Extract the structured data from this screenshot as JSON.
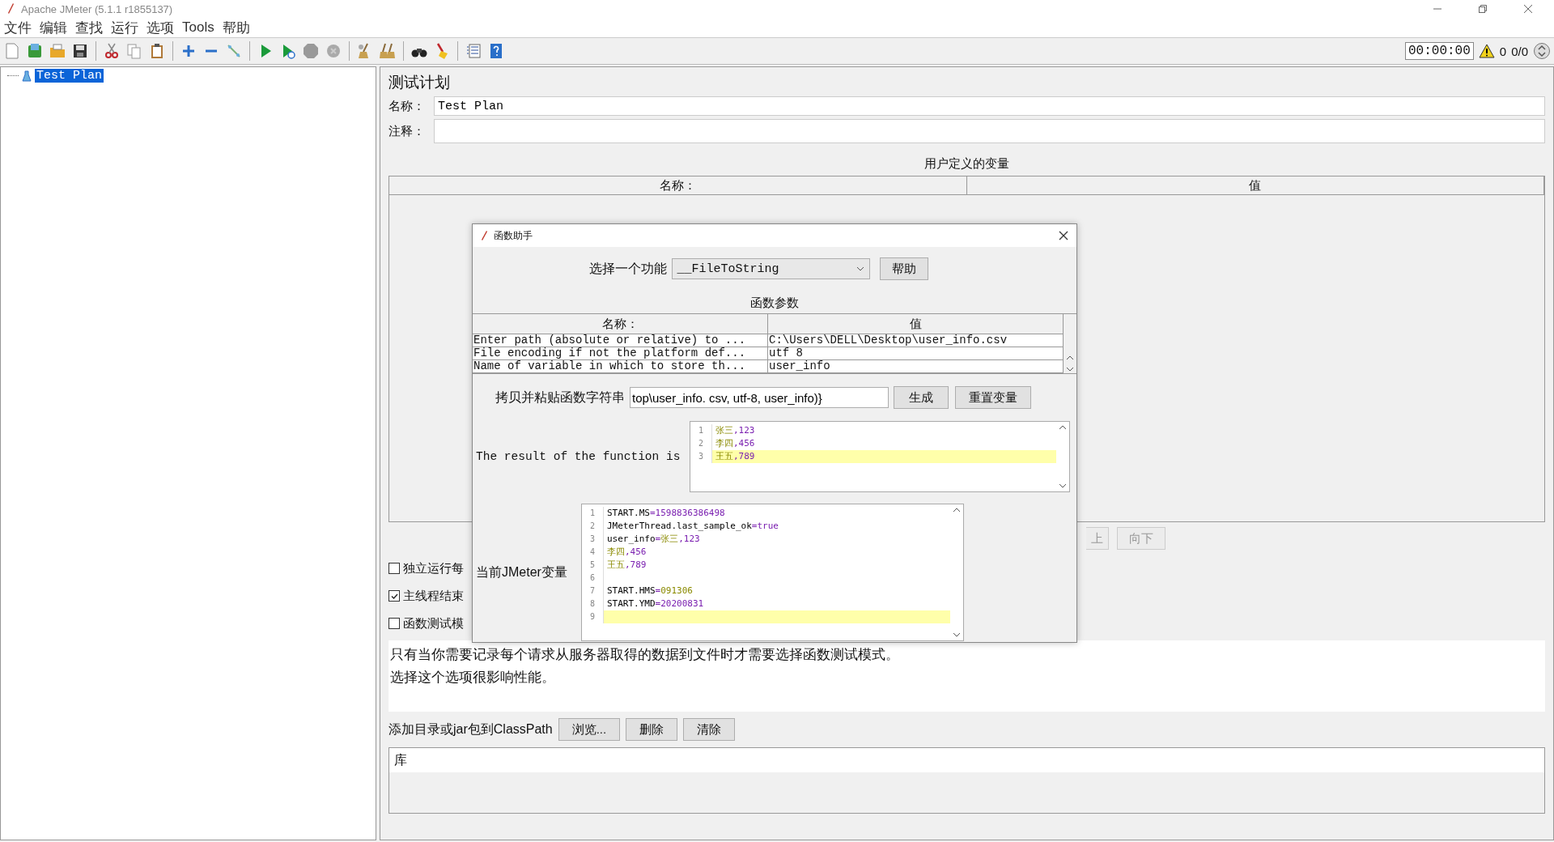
{
  "window": {
    "title": "Apache JMeter (5.1.1 r1855137)"
  },
  "menu": [
    "文件",
    "编辑",
    "查找",
    "运行",
    "选项",
    "Tools",
    "帮助"
  ],
  "status": {
    "timer": "00:00:00",
    "warnings": "0",
    "threads": "0/0"
  },
  "tree": [
    {
      "label": "Test Plan",
      "selected": true
    }
  ],
  "test_plan": {
    "title": "测试计划",
    "name_label": "名称：",
    "name": "Test Plan",
    "comment_label": "注释：",
    "variables": {
      "title": "用户定义的变量",
      "columns": [
        "名称：",
        "值"
      ]
    },
    "buttons": [
      "上",
      "向下"
    ],
    "options": [
      {
        "label": "独立运行每",
        "checked": false
      },
      {
        "label": "主线程结束",
        "checked": true
      },
      {
        "label": "函数测试模",
        "checked": false
      }
    ],
    "note": [
      "只有当你需要记录每个请求从服务器取得的数据到文件时才需要选择函数测试模式。",
      "选择这个选项很影响性能。"
    ],
    "classpath": {
      "label": "添加目录或jar包到ClassPath",
      "buttons": [
        "浏览...",
        "删除",
        "清除"
      ],
      "column": "库"
    }
  },
  "dialog": {
    "title": "函数助手",
    "function_label": "选择一个功能",
    "function": "__FileToString",
    "help": "帮助",
    "params_title": "函数参数",
    "columns": [
      "名称：",
      "值"
    ],
    "params": [
      {
        "name": "Enter path (absolute or relative) to ...",
        "value": "C:\\Users\\DELL\\Desktop\\user_info.csv"
      },
      {
        "name": "File encoding if not the platform def...",
        "value": "utf 8"
      },
      {
        "name": "Name of variable in which to store th...",
        "value": "user_info"
      }
    ],
    "copy_label": "拷贝并粘贴函数字符串",
    "function_string": "top\\user_info. csv, utf-8, user_info)}",
    "buttons": [
      "生成",
      "重置变量"
    ],
    "result_label": "The result of the function is",
    "result": [
      {
        "number": "1",
        "current": false,
        "segments": [
          {
            "text": "张三",
            "kind": "word"
          },
          {
            "text": ",123",
            "kind": "number"
          }
        ]
      },
      {
        "number": "2",
        "current": false,
        "segments": [
          {
            "text": "李四",
            "kind": "word"
          },
          {
            "text": ",456",
            "kind": "number"
          }
        ]
      },
      {
        "number": "3",
        "current": true,
        "segments": [
          {
            "text": "王五",
            "kind": "word"
          },
          {
            "text": ",789",
            "kind": "number"
          }
        ]
      }
    ],
    "vars_label": "当前JMeter变量",
    "vars": [
      {
        "number": "1",
        "current": false,
        "segments": [
          {
            "text": "START.MS",
            "kind": "plain"
          },
          {
            "text": "=",
            "kind": "op"
          },
          {
            "text": "1598836386498",
            "kind": "number"
          }
        ]
      },
      {
        "number": "2",
        "current": false,
        "segments": [
          {
            "text": "JMeterThread.last_sample_ok",
            "kind": "plain"
          },
          {
            "text": "=",
            "kind": "op"
          },
          {
            "text": "true",
            "kind": "number"
          }
        ]
      },
      {
        "number": "3",
        "current": false,
        "segments": [
          {
            "text": "user_info",
            "kind": "plain"
          },
          {
            "text": "=",
            "kind": "op"
          },
          {
            "text": "张三",
            "kind": "word"
          },
          {
            "text": ",123",
            "kind": "number"
          }
        ]
      },
      {
        "number": "4",
        "current": false,
        "segments": [
          {
            "text": "李四",
            "kind": "word"
          },
          {
            "text": ",456",
            "kind": "number"
          }
        ]
      },
      {
        "number": "5",
        "current": false,
        "segments": [
          {
            "text": "王五",
            "kind": "word"
          },
          {
            "text": ",789",
            "kind": "number"
          }
        ]
      },
      {
        "number": "6",
        "current": false
      },
      {
        "number": "7",
        "current": false,
        "segments": [
          {
            "text": "START.HMS",
            "kind": "plain"
          },
          {
            "text": "=",
            "kind": "op"
          },
          {
            "text": "091306",
            "kind": "word"
          }
        ]
      },
      {
        "number": "8",
        "current": false,
        "segments": [
          {
            "text": "START.YMD",
            "kind": "plain"
          },
          {
            "text": "=",
            "kind": "op"
          },
          {
            "text": "20200831",
            "kind": "number"
          }
        ]
      },
      {
        "number": "9",
        "current": true
      }
    ]
  }
}
